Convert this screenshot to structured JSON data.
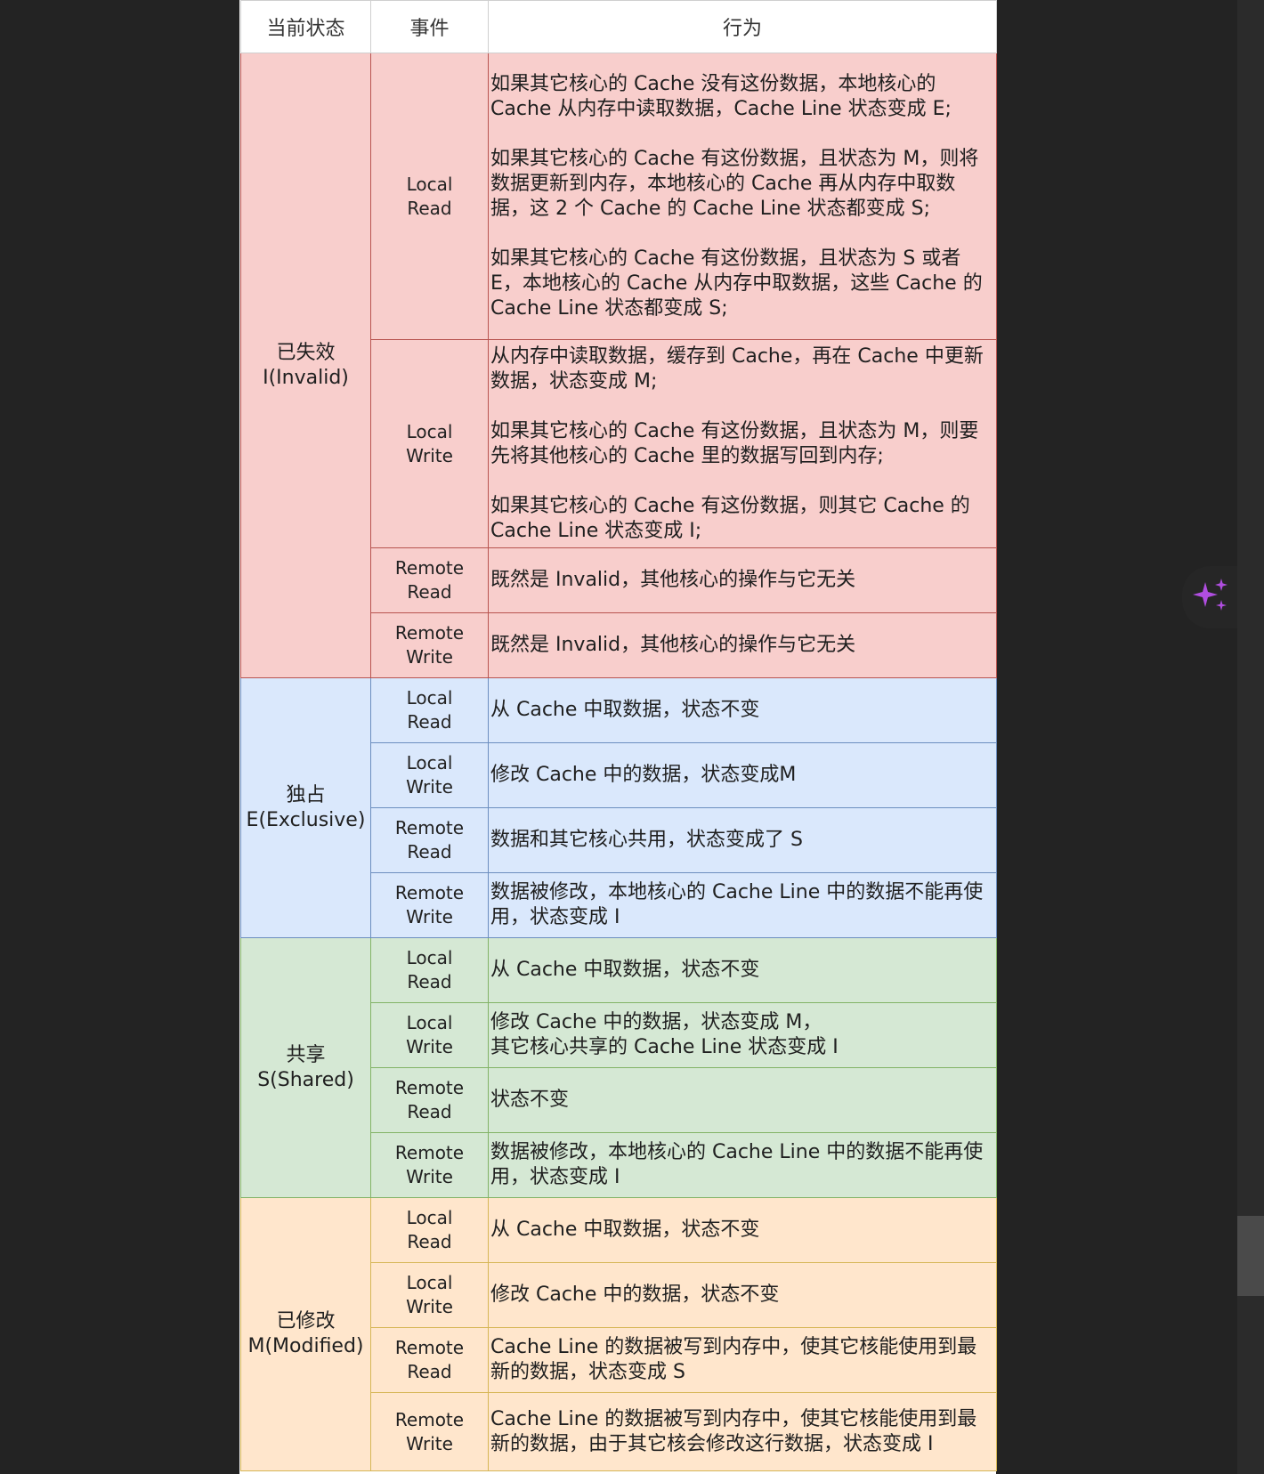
{
  "header": {
    "state": "当前状态",
    "event": "事件",
    "action": "行为"
  },
  "groups": {
    "invalid": {
      "state": [
        "已失效",
        "I(Invalid)"
      ],
      "rows": [
        {
          "event": [
            "Local",
            "Read"
          ],
          "paras": [
            "如果其它核心的 Cache 没有这份数据，本地核心的 Cache 从内存中读取数据，Cache Line 状态变成 E;",
            "如果其它核心的 Cache 有这份数据，且状态为 M，则将数据更新到内存，本地核心的 Cache 再从内存中取数据，这 2 个 Cache 的 Cache Line 状态都变成 S;",
            "如果其它核心的 Cache 有这份数据，且状态为 S 或者 E，本地核心的 Cache 从内存中取数据，这些 Cache 的 Cache Line 状态都变成 S;"
          ]
        },
        {
          "event": [
            "Local",
            "Write"
          ],
          "paras": [
            "从内存中读取数据，缓存到 Cache，再在 Cache 中更新数据，状态变成 M;",
            "如果其它核心的 Cache 有这份数据，且状态为 M，则要先将其他核心的 Cache 里的数据写回到内存;",
            "如果其它核心的 Cache 有这份数据，则其它 Cache 的 Cache Line 状态变成 I;"
          ]
        },
        {
          "event": [
            "Remote",
            "Read"
          ],
          "paras": [
            "既然是 Invalid，其他核心的操作与它无关"
          ]
        },
        {
          "event": [
            "Remote",
            "Write"
          ],
          "paras": [
            "既然是 Invalid，其他核心的操作与它无关"
          ]
        }
      ]
    },
    "exclusive": {
      "state": [
        "独占",
        "E(Exclusive)"
      ],
      "rows": [
        {
          "event": [
            "Local",
            "Read"
          ],
          "paras": [
            "从 Cache 中取数据，状态不变"
          ]
        },
        {
          "event": [
            "Local",
            "Write"
          ],
          "paras": [
            "修改 Cache 中的数据，状态变成M"
          ]
        },
        {
          "event": [
            "Remote",
            "Read"
          ],
          "paras": [
            "数据和其它核心共用，状态变成了 S"
          ]
        },
        {
          "event": [
            "Remote",
            "Write"
          ],
          "paras": [
            "数据被修改，本地核心的 Cache Line 中的数据不能再使用，状态变成 I"
          ]
        }
      ]
    },
    "shared": {
      "state": [
        "共享",
        "S(Shared)"
      ],
      "rows": [
        {
          "event": [
            "Local",
            "Read"
          ],
          "paras": [
            "从 Cache 中取数据，状态不变"
          ]
        },
        {
          "event": [
            "Local",
            "Write"
          ],
          "paras": [
            "修改 Cache 中的数据，状态变成 M，\n其它核心共享的 Cache Line 状态变成 I"
          ]
        },
        {
          "event": [
            "Remote",
            "Read"
          ],
          "paras": [
            "状态不变"
          ]
        },
        {
          "event": [
            "Remote",
            "Write"
          ],
          "paras": [
            "数据被修改，本地核心的 Cache Line 中的数据不能再使用，状态变成 I"
          ]
        }
      ]
    },
    "modified": {
      "state": [
        "已修改",
        "M(Modified)"
      ],
      "rows": [
        {
          "event": [
            "Local",
            "Read"
          ],
          "paras": [
            "从 Cache 中取数据，状态不变"
          ]
        },
        {
          "event": [
            "Local",
            "Write"
          ],
          "paras": [
            "修改 Cache 中的数据，状态不变"
          ]
        },
        {
          "event": [
            "Remote",
            "Read"
          ],
          "paras": [
            "Cache Line 的数据被写到内存中，使其它核能使用到最新的数据，状态变成 S"
          ]
        },
        {
          "event": [
            "Remote",
            "Write"
          ],
          "paras": [
            "Cache Line 的数据被写到内存中，使其它核能使用到最新的数据，由于其它核会修改这行数据，状态变成 I"
          ]
        }
      ]
    }
  },
  "colors": {
    "invalid": "#f8cecc",
    "exclusive": "#dae8fc",
    "shared": "#d5e8d4",
    "modified": "#ffe6cc",
    "sparkle": "#b04ee0"
  },
  "icons": {
    "ai_button": "sparkle-icon"
  }
}
